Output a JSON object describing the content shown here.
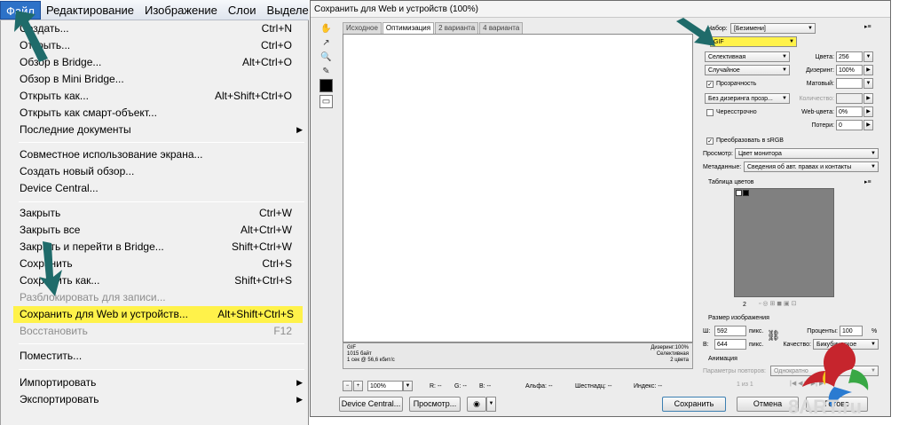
{
  "menubar": {
    "items": [
      {
        "label": "Файл",
        "active": true
      },
      {
        "label": "Редактирование"
      },
      {
        "label": "Изображение"
      },
      {
        "label": "Слои"
      },
      {
        "label": "Выделе"
      }
    ]
  },
  "file_menu": {
    "items": [
      {
        "label": "Создать...",
        "shortcut": "Ctrl+N"
      },
      {
        "label": "Открыть...",
        "shortcut": "Ctrl+O"
      },
      {
        "label": "Обзор в Bridge...",
        "shortcut": "Alt+Ctrl+O"
      },
      {
        "label": "Обзор в Mini Bridge...",
        "shortcut": ""
      },
      {
        "label": "Открыть как...",
        "shortcut": "Alt+Shift+Ctrl+O"
      },
      {
        "label": "Открыть как смарт-объект...",
        "shortcut": ""
      },
      {
        "label": "Последние документы",
        "shortcut": "",
        "submenu": "▶"
      },
      {
        "label": "Совместное использование экрана...",
        "shortcut": ""
      },
      {
        "label": "Создать новый обзор...",
        "shortcut": ""
      },
      {
        "label": "Device Central...",
        "shortcut": ""
      },
      {
        "label": "Закрыть",
        "shortcut": "Ctrl+W"
      },
      {
        "label": "Закрыть все",
        "shortcut": "Alt+Ctrl+W"
      },
      {
        "label": "Закрыть и перейти в Bridge...",
        "shortcut": "Shift+Ctrl+W"
      },
      {
        "label": "Сохранить",
        "shortcut": "Ctrl+S"
      },
      {
        "label": "Сохранить как...",
        "shortcut": "Shift+Ctrl+S"
      },
      {
        "label": "Разблокировать для записи...",
        "shortcut": "",
        "disabled": true
      },
      {
        "label": "Сохранить для Web и устройств...",
        "shortcut": "Alt+Shift+Ctrl+S",
        "highlighted": true
      },
      {
        "label": "Восстановить",
        "shortcut": "F12",
        "disabled": true
      },
      {
        "label": "Поместить...",
        "shortcut": ""
      },
      {
        "label": "Импортировать",
        "shortcut": "",
        "submenu": "▶"
      },
      {
        "label": "Экспортировать",
        "shortcut": "",
        "submenu": "▶"
      }
    ]
  },
  "dialog": {
    "title": "Сохранить для Web и устройств (100%)",
    "tabs": [
      "Исходное",
      "Оптимизация",
      "2 варианта",
      "4 варианта"
    ],
    "active_tab": 1,
    "canvas_info": {
      "format": "GIF",
      "size": "1015 байт",
      "speed": "1 сек @ 56,6 кбит/с",
      "dither": "Дизеринг:100%",
      "palette": "Селективная",
      "colors": "2 цвета"
    },
    "zoom": "100%",
    "readouts": {
      "r": "R: --",
      "g": "G: --",
      "b": "B: --",
      "alpha": "Альфа: --",
      "hex": "Шестнадц: --",
      "index": "Индекс: --"
    },
    "buttons": {
      "device_central": "Device Central...",
      "preview": "Просмотр...",
      "save": "Сохранить",
      "cancel": "Отмена",
      "done": "Готово"
    },
    "settings": {
      "preset_label": "Набор:",
      "preset_value": "[Безимени]",
      "format_value": "GIF",
      "palette_value": "Селективная",
      "colors_label": "Цвета:",
      "colors_value": "256",
      "dither_type": "Случайное",
      "dither_label": "Дизеринг:",
      "dither_value": "100%",
      "transparency_label": "Прозрачность",
      "matte_label": "Матовый:",
      "transp_dither": "Без дизеринга прозр...",
      "amount_label": "Количество:",
      "interlaced_label": "Чересстрочно",
      "web_snap_label": "Web-цвета:",
      "web_snap_value": "0%",
      "lossy_label": "Потери:",
      "lossy_value": "0",
      "srgb_label": "Преобразовать в sRGB",
      "preview_label": "Просмотр:",
      "preview_value": "Цвет монитора",
      "metadata_label": "Метаданные:",
      "metadata_value": "Сведения об авт. правах и контакты"
    },
    "color_table": {
      "title": "Таблица цветов",
      "count": "2"
    },
    "image_size": {
      "title": "Размер изображения",
      "w_label": "Ш:",
      "w_value": "592",
      "h_label": "В:",
      "h_value": "644",
      "unit": "пикс.",
      "percent_label": "Проценты:",
      "percent_value": "100",
      "percent_unit": "%",
      "quality_label": "Качество:",
      "quality_value": "Бикубическое"
    },
    "animation": {
      "title": "Анимация",
      "loop_label": "Параметры повторов:",
      "loop_value": "Однократно",
      "frame": "1 из 1"
    }
  },
  "watermark": {
    "text": "8ART.ru"
  },
  "colors": {
    "highlight": "#fff24a",
    "arrow": "#1f6b6a",
    "menu_active": "#2d72c8"
  }
}
